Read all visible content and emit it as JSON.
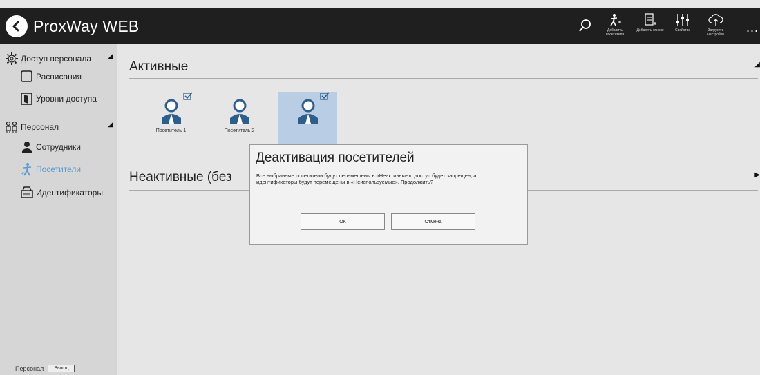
{
  "header": {
    "title": "ProxWay WEB",
    "toolbar": [
      {
        "icon": "add-visitor-icon",
        "label": "Добавить посетителя"
      },
      {
        "icon": "add-list-icon",
        "label": "Добавить список"
      },
      {
        "icon": "properties-icon",
        "label": "Свойства"
      },
      {
        "icon": "upload-settings-icon",
        "label": "Загрузить настройки"
      }
    ],
    "more": "..."
  },
  "sidebar": {
    "groups": [
      {
        "label": "Доступ персонала",
        "icon": "gear-icon",
        "items": [
          {
            "label": "Расписания",
            "icon": "calendar-icon"
          },
          {
            "label": "Уровни доступа",
            "icon": "door-icon"
          }
        ]
      },
      {
        "label": "Персонал",
        "icon": "people-icon",
        "items": [
          {
            "label": "Сотрудники",
            "icon": "employee-icon"
          },
          {
            "label": "Посетители",
            "icon": "visitor-icon",
            "active": true
          },
          {
            "label": "Идентификаторы",
            "icon": "card-reader-icon"
          }
        ]
      }
    ],
    "footer": {
      "user": "Персонал",
      "logout": "Выход"
    }
  },
  "main": {
    "active_title": "Активные",
    "inactive_title": "Неактивные (без",
    "visitors": [
      {
        "label": "Посетитель 1",
        "checked": true,
        "selected": false
      },
      {
        "label": "Посетитель 2",
        "checked": false,
        "selected": false
      },
      {
        "label": "",
        "checked": true,
        "selected": true
      }
    ]
  },
  "dialog": {
    "title": "Деактивация посетителей",
    "message": "Все выбранные посетители будут перемещены в «Неактивные», доступ будет запрещен, а идентификаторы будут перемещены в «Неиспользуемые». Продолжить?",
    "ok": "ОК",
    "cancel": "Отмена"
  },
  "colors": {
    "header_bg": "#1f1f1f",
    "sidebar_bg": "#d6d6d6",
    "accent": "#5b9bd5",
    "selected_bg": "#b9cde5"
  }
}
